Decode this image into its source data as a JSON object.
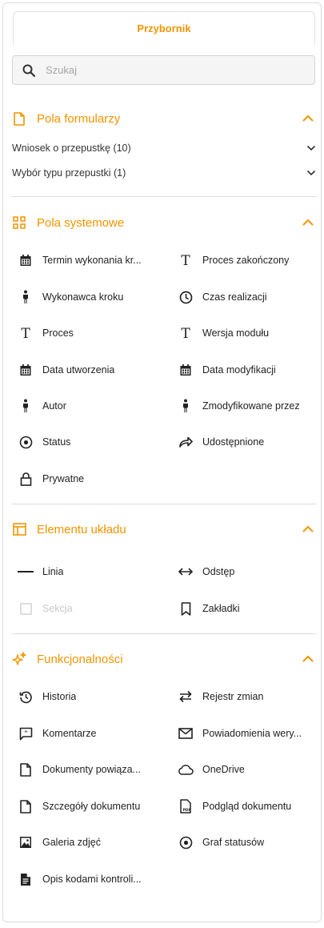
{
  "tab": {
    "label": "Przybornik"
  },
  "search": {
    "placeholder": "Szukaj"
  },
  "colors": {
    "accent": "#f29400",
    "divider": "#dcdcdc"
  },
  "sections": {
    "form_fields": {
      "title": "Pola formularzy",
      "icon": "document-icon",
      "subgroups": [
        {
          "label": "Wniosek o przepustkę (10)"
        },
        {
          "label": "Wybór typu przepustki (1)"
        }
      ]
    },
    "system_fields": {
      "title": "Pola systemowe",
      "icon": "grid-icon",
      "items": [
        {
          "label": "Termin wykonania kr...",
          "icon": "calendar-icon"
        },
        {
          "label": "Proces zakończony",
          "icon": "text-icon"
        },
        {
          "label": "Wykonawca kroku",
          "icon": "person-icon"
        },
        {
          "label": "Czas realizacji",
          "icon": "clock-icon"
        },
        {
          "label": "Proces",
          "icon": "text-icon"
        },
        {
          "label": "Wersja modułu",
          "icon": "text-icon"
        },
        {
          "label": "Data utworzenia",
          "icon": "calendar-icon"
        },
        {
          "label": "Data modyfikacji",
          "icon": "calendar-icon"
        },
        {
          "label": "Autor",
          "icon": "person-icon"
        },
        {
          "label": "Zmodyfikowane przez",
          "icon": "person-icon"
        },
        {
          "label": "Status",
          "icon": "radio-icon"
        },
        {
          "label": "Udostępnione",
          "icon": "share-icon"
        },
        {
          "label": "Prywatne",
          "icon": "lock-icon"
        }
      ]
    },
    "layout_elements": {
      "title": "Elementu układu",
      "icon": "layout-icon",
      "items": [
        {
          "label": "Linia",
          "icon": "line-icon"
        },
        {
          "label": "Odstęp",
          "icon": "spacing-icon"
        },
        {
          "label": "Sekcja",
          "icon": "section-icon",
          "disabled": true
        },
        {
          "label": "Zakładki",
          "icon": "bookmark-icon"
        }
      ]
    },
    "features": {
      "title": "Funkcjonalności",
      "icon": "sparkle-icon",
      "items": [
        {
          "label": "Historia",
          "icon": "history-icon"
        },
        {
          "label": "Rejestr zmian",
          "icon": "swap-icon"
        },
        {
          "label": "Komentarze",
          "icon": "comment-icon"
        },
        {
          "label": "Powiadomienia wery...",
          "icon": "mail-icon"
        },
        {
          "label": "Dokumenty powiąza...",
          "icon": "document-icon"
        },
        {
          "label": "OneDrive",
          "icon": "cloud-icon"
        },
        {
          "label": "Szczegóły dokumentu",
          "icon": "document-icon"
        },
        {
          "label": "Podgląd dokumentu",
          "icon": "pdf-icon"
        },
        {
          "label": "Galeria zdjęć",
          "icon": "image-icon"
        },
        {
          "label": "Graf statusów",
          "icon": "radio-icon"
        },
        {
          "label": "Opis kodami kontroli...",
          "icon": "doc-lines-icon"
        }
      ]
    }
  }
}
